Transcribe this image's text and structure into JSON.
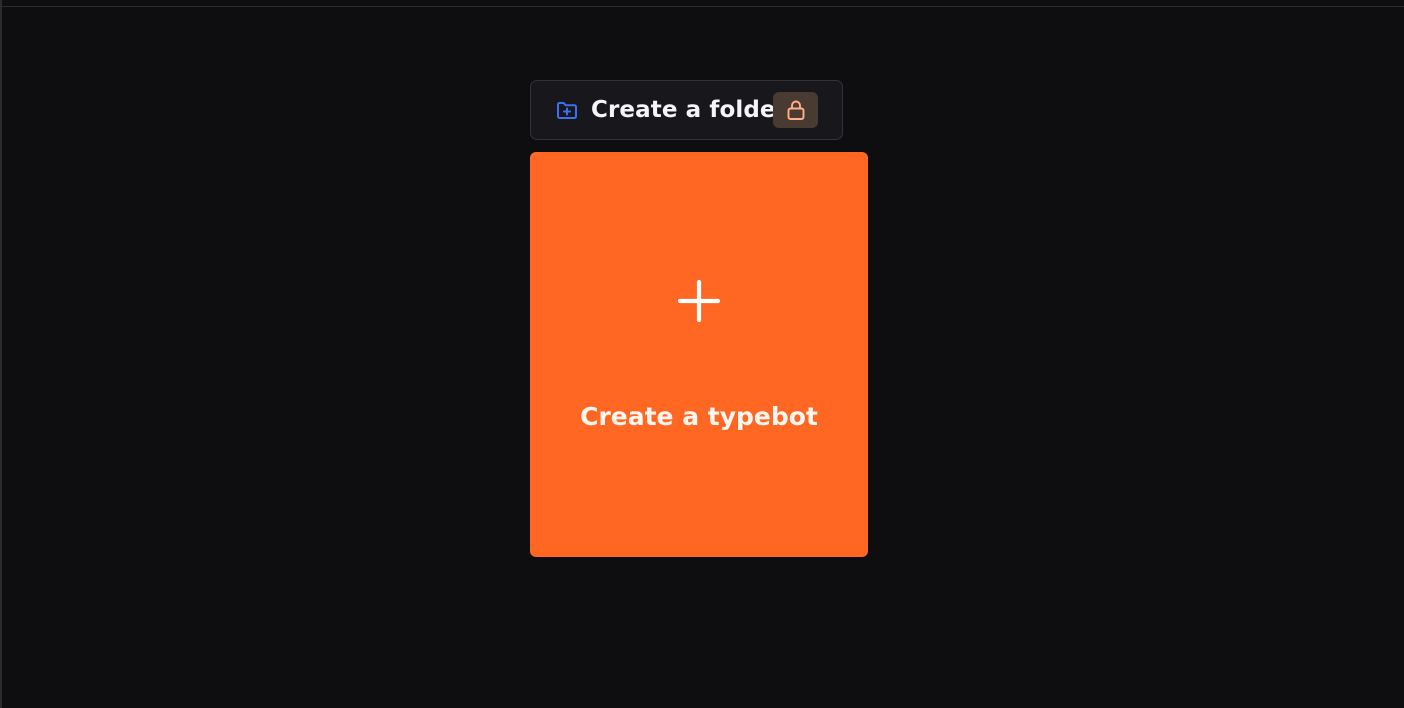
{
  "folder_button": {
    "label": "Create a folder",
    "icon": "folder-plus-icon",
    "badge_icon": "lock-icon"
  },
  "typebot_card": {
    "label": "Create a typebot",
    "icon": "plus-icon"
  },
  "colors": {
    "background": "#0e0d10",
    "accent": "#ff6723",
    "folder_icon": "#3b6ef5",
    "lock_icon": "#ffb089"
  }
}
